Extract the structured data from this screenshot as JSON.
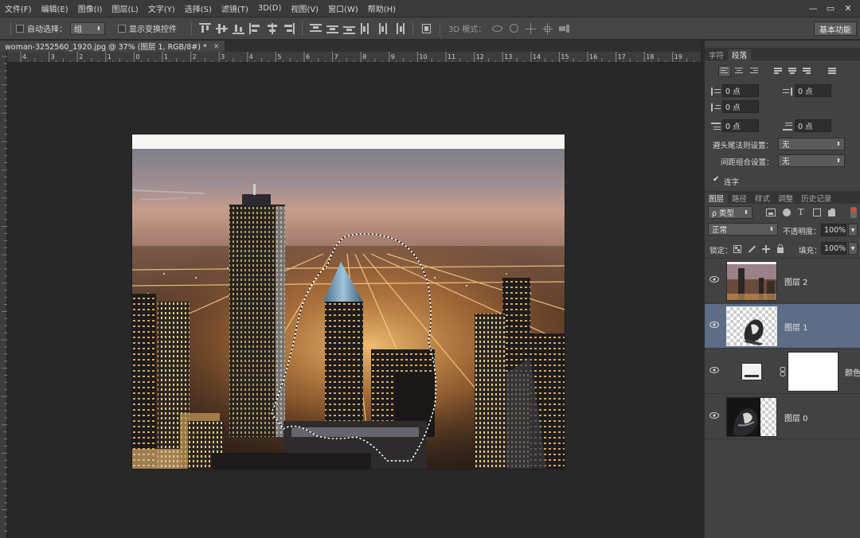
{
  "menu": [
    "文件(F)",
    "编辑(E)",
    "图像(I)",
    "图层(L)",
    "文字(Y)",
    "选择(S)",
    "滤镜(T)",
    "3D(D)",
    "视图(V)",
    "窗口(W)",
    "帮助(H)"
  ],
  "window_controls": {
    "minimize": "—",
    "restore": "▭",
    "close": "✕"
  },
  "options_bar": {
    "auto_select_label": "自动选择：",
    "auto_select_value": "组",
    "show_transform_label": "显示变换控件",
    "mode_3d_label": "3D 模式：",
    "workspace_label": "基本功能"
  },
  "document": {
    "tab_title": "woman-3252560_1920.jpg @ 37% (图层 1, RGB/8#) *",
    "close": "×",
    "ruler_ticks": [
      "4",
      "3",
      "2",
      "1",
      "0",
      "1",
      "2",
      "3",
      "4",
      "5",
      "6",
      "7",
      "8",
      "9",
      "10",
      "11",
      "12",
      "13",
      "14",
      "15",
      "16",
      "17",
      "18",
      "19"
    ]
  },
  "paragraph_panel": {
    "tabs": [
      "字符",
      "段落"
    ],
    "fields": {
      "indent_left": "0 点",
      "indent_right": "0 点",
      "first_line": "0 点",
      "space_before": "0 点",
      "space_after": "0 点"
    },
    "kinsoku_label": "避头尾法则设置：",
    "kinsoku_value": "无",
    "mojikumi_label": "间距组合设置：",
    "mojikumi_value": "无",
    "hyphenate_label": "连字"
  },
  "layers_panel": {
    "tabs": [
      "图层",
      "路径",
      "样式",
      "调整",
      "历史记录"
    ],
    "filter_kind": "ρ 类型",
    "blend_mode": "正常",
    "opacity_label": "不透明度：",
    "opacity_value": "100%",
    "lock_label": "锁定：",
    "fill_label": "填充：",
    "fill_value": "100%",
    "layers": [
      {
        "name": "图层 2"
      },
      {
        "name": "图层 1"
      },
      {
        "name": "颜色"
      },
      {
        "name": "图层 0"
      }
    ]
  }
}
